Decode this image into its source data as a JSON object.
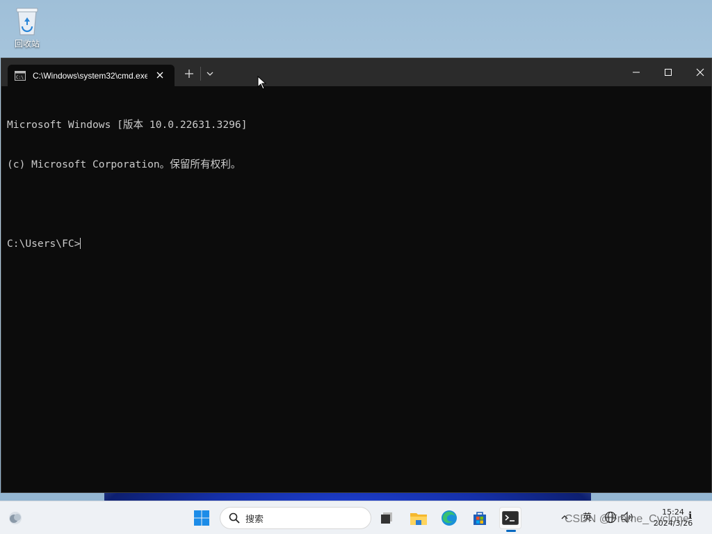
{
  "desktop": {
    "recycle_bin_label": "回收站"
  },
  "terminal": {
    "tab_title": "C:\\Windows\\system32\\cmd.exe",
    "lines": [
      "Microsoft Windows [版本 10.0.22631.3296]",
      "(c) Microsoft Corporation。保留所有权利。",
      "",
      "C:\\Users\\FC>"
    ]
  },
  "taskbar": {
    "search_placeholder": "搜索",
    "apps": [
      "task-view",
      "file-explorer",
      "edge",
      "microsoft-store",
      "terminal"
    ],
    "active_app": "terminal",
    "tray_ime": "英",
    "clock_time": "15:24",
    "clock_date": "2024/3/26",
    "notification_badge": "ℹ"
  },
  "watermark": "CSDN @Frame_Cyclone",
  "colors": {
    "console_bg": "#0c0c0c",
    "console_text": "#cccccc",
    "titlebar_bg": "#2b2b2b",
    "taskbar_bg": "#eef1f5",
    "accent": "#0067c0"
  }
}
